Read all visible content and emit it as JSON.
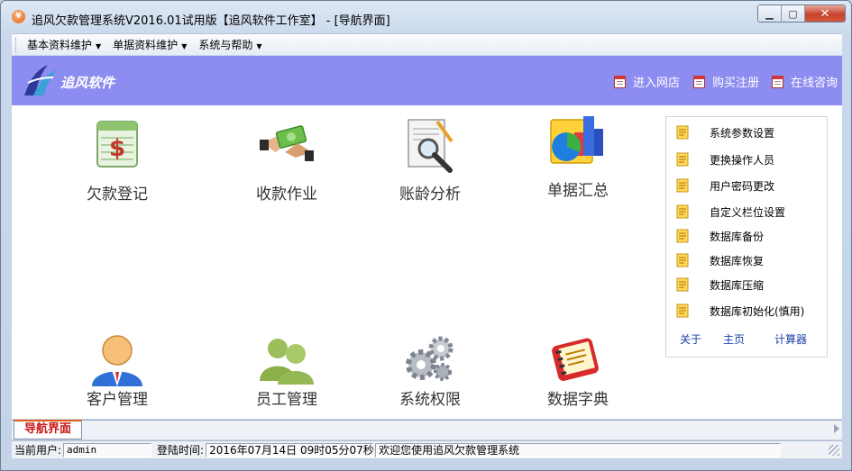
{
  "window": {
    "title": "追风欠款管理系统V2016.01试用版【追风软件工作室】 - [导航界面]",
    "app_icon_glyph": "¥",
    "minimize_glyph": "▁",
    "maximize_glyph": "▢",
    "close_glyph": "✕"
  },
  "menu": {
    "items": [
      {
        "label": "基本资料维护",
        "arrow": "▼"
      },
      {
        "label": "单据资料维护",
        "arrow": "▼"
      },
      {
        "label": "系统与帮助",
        "arrow": "▼"
      }
    ]
  },
  "banner": {
    "brand": "追风软件",
    "links": [
      {
        "label": "进入网店",
        "icon": "calendar-icon"
      },
      {
        "label": "购买注册",
        "icon": "calendar-icon"
      },
      {
        "label": "在线咨询",
        "icon": "calendar-icon"
      }
    ],
    "color": "#8d8cf0"
  },
  "tiles": [
    {
      "label": "欠款登记",
      "icon": "ledger-money-icon"
    },
    {
      "label": "收款作业",
      "icon": "cash-handshake-icon"
    },
    {
      "label": "账龄分析",
      "icon": "magnifier-document-icon"
    },
    {
      "label": "单据汇总",
      "icon": "charts-icon"
    },
    {
      "label": "客户管理",
      "icon": "user-icon"
    },
    {
      "label": "员工管理",
      "icon": "users-icon"
    },
    {
      "label": "系统权限",
      "icon": "gears-icon"
    },
    {
      "label": "数据字典",
      "icon": "address-book-icon"
    }
  ],
  "side_panel": {
    "items": [
      {
        "label": "系统参数设置"
      },
      {
        "label": "更换操作人员"
      },
      {
        "label": "用户密码更改"
      },
      {
        "label": "自定义栏位设置"
      },
      {
        "label": "数据库备份"
      },
      {
        "label": "数据库恢复"
      },
      {
        "label": "数据库压缩"
      },
      {
        "label": "数据库初始化(慎用)"
      }
    ],
    "links": [
      {
        "label": "关于"
      },
      {
        "label": "主页"
      },
      {
        "label": "计算器"
      }
    ]
  },
  "tabs": [
    {
      "label": "导航界面"
    }
  ],
  "status": {
    "user_label": "当前用户:",
    "user_value": "admin",
    "login_label": "登陆时间:",
    "login_value": "2016年07月14日 09时05分07秒",
    "message": "欢迎您使用追风欠款管理系统"
  },
  "colors": {
    "accent_red": "#c81818",
    "link_blue": "#1a3fa8"
  }
}
